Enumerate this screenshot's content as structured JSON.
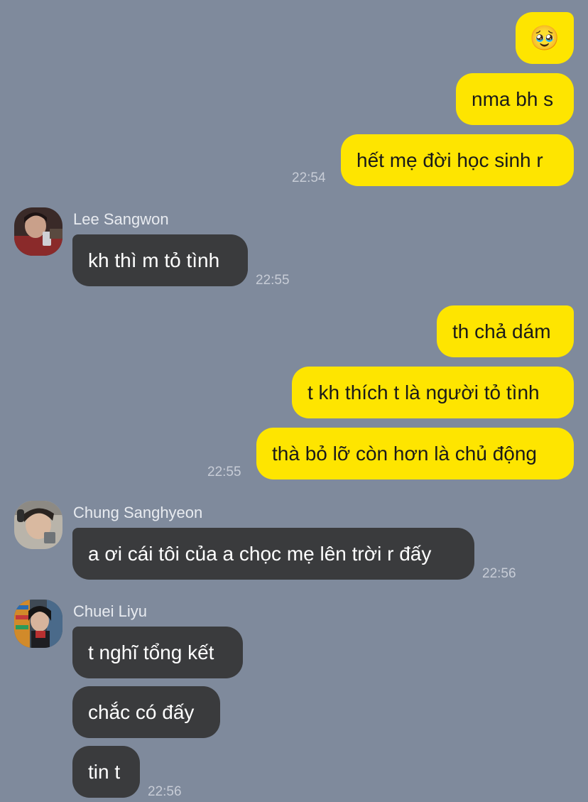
{
  "messages": {
    "out_group1": {
      "emoji": "🥹",
      "m1": "nma bh s",
      "m2": "hết mẹ đời học sinh r",
      "time": "22:54"
    },
    "lee": {
      "name": "Lee Sangwon",
      "m1": "kh thì m tỏ tình",
      "time": "22:55"
    },
    "out_group2": {
      "m1": "th chả dám",
      "m2": "t kh thích t là người tỏ tình",
      "m3": "thà bỏ lỡ còn hơn là chủ động",
      "time": "22:55"
    },
    "chung": {
      "name": "Chung Sanghyeon",
      "m1": "a ơi cái tôi của a chọc mẹ lên trời r đấy",
      "time": "22:56"
    },
    "chuei": {
      "name": "Chuei Liyu",
      "m1": "t nghĩ tổng kết",
      "m2": "chắc có đấy",
      "m3": "tin t",
      "time": "22:56"
    }
  },
  "colors": {
    "background": "#7f8a9c",
    "outgoing_bubble": "#fee500",
    "incoming_bubble": "#3a3b3d"
  }
}
